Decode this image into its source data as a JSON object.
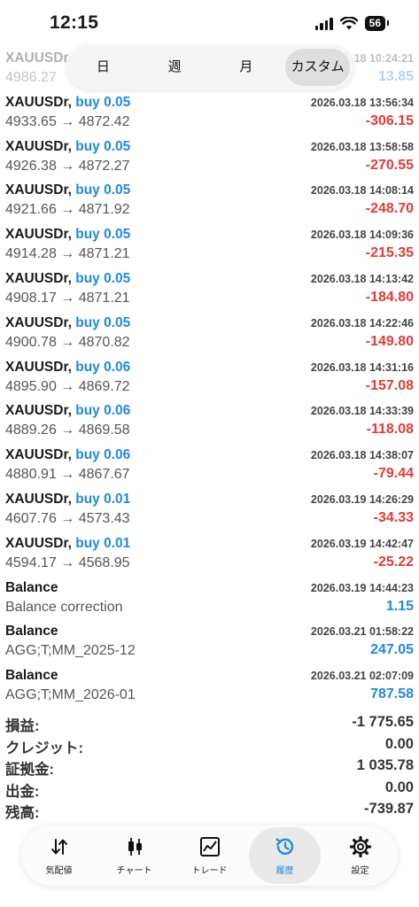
{
  "status_bar": {
    "time": "12:15",
    "battery": "56"
  },
  "partial_row": {
    "symbol": "XAUUSDr,",
    "datetime": "18 10:24:21",
    "prices": "4986.27",
    "profit": "13.85"
  },
  "period_tabs": [
    {
      "label": "日",
      "active": false
    },
    {
      "label": "週",
      "active": false
    },
    {
      "label": "月",
      "active": false
    },
    {
      "label": "カスタム",
      "active": true
    }
  ],
  "deals": [
    {
      "symbol": "XAUUSDr,",
      "direction": "buy 0.05",
      "datetime": "2026.03.18 13:56:34",
      "prices": "4933.65 → 4872.42",
      "profit": "-306.15",
      "sign": "neg"
    },
    {
      "symbol": "XAUUSDr,",
      "direction": "buy 0.05",
      "datetime": "2026.03.18 13:58:58",
      "prices": "4926.38 → 4872.27",
      "profit": "-270.55",
      "sign": "neg"
    },
    {
      "symbol": "XAUUSDr,",
      "direction": "buy 0.05",
      "datetime": "2026.03.18 14:08:14",
      "prices": "4921.66 → 4871.92",
      "profit": "-248.70",
      "sign": "neg"
    },
    {
      "symbol": "XAUUSDr,",
      "direction": "buy 0.05",
      "datetime": "2026.03.18 14:09:36",
      "prices": "4914.28 → 4871.21",
      "profit": "-215.35",
      "sign": "neg"
    },
    {
      "symbol": "XAUUSDr,",
      "direction": "buy 0.05",
      "datetime": "2026.03.18 14:13:42",
      "prices": "4908.17 → 4871.21",
      "profit": "-184.80",
      "sign": "neg"
    },
    {
      "symbol": "XAUUSDr,",
      "direction": "buy 0.05",
      "datetime": "2026.03.18 14:22:46",
      "prices": "4900.78 → 4870.82",
      "profit": "-149.80",
      "sign": "neg"
    },
    {
      "symbol": "XAUUSDr,",
      "direction": "buy 0.06",
      "datetime": "2026.03.18 14:31:16",
      "prices": "4895.90 → 4869.72",
      "profit": "-157.08",
      "sign": "neg"
    },
    {
      "symbol": "XAUUSDr,",
      "direction": "buy 0.06",
      "datetime": "2026.03.18 14:33:39",
      "prices": "4889.26 → 4869.58",
      "profit": "-118.08",
      "sign": "neg"
    },
    {
      "symbol": "XAUUSDr,",
      "direction": "buy 0.06",
      "datetime": "2026.03.18 14:38:07",
      "prices": "4880.91 → 4867.67",
      "profit": "-79.44",
      "sign": "neg"
    },
    {
      "symbol": "XAUUSDr,",
      "direction": "buy 0.01",
      "datetime": "2026.03.19 14:26:29",
      "prices": "4607.76 → 4573.43",
      "profit": "-34.33",
      "sign": "neg"
    },
    {
      "symbol": "XAUUSDr,",
      "direction": "buy 0.01",
      "datetime": "2026.03.19 14:42:47",
      "prices": "4594.17 → 4568.95",
      "profit": "-25.22",
      "sign": "neg"
    },
    {
      "symbol": "Balance",
      "direction": "",
      "datetime": "2026.03.19 14:44:23",
      "prices": "Balance correction",
      "profit": "1.15",
      "sign": "pos"
    },
    {
      "symbol": "Balance",
      "direction": "",
      "datetime": "2026.03.21 01:58:22",
      "prices": "AGG;T;MM_2025-12",
      "profit": "247.05",
      "sign": "pos"
    },
    {
      "symbol": "Balance",
      "direction": "",
      "datetime": "2026.03.21 02:07:09",
      "prices": "AGG;T;MM_2026-01",
      "profit": "787.58",
      "sign": "pos"
    }
  ],
  "summary": [
    {
      "label": "損益:",
      "value": "-1 775.65"
    },
    {
      "label": "クレジット:",
      "value": "0.00"
    },
    {
      "label": "証拠金:",
      "value": "1 035.78"
    },
    {
      "label": "出金:",
      "value": "0.00"
    },
    {
      "label": "残高:",
      "value": "-739.87"
    }
  ],
  "tab_bar": [
    {
      "label": "気配値",
      "icon": "quotes-arrows-icon",
      "active": false
    },
    {
      "label": "チャート",
      "icon": "candlestick-chart-icon",
      "active": false
    },
    {
      "label": "トレード",
      "icon": "trade-line-chart-icon",
      "active": false
    },
    {
      "label": "履歴",
      "icon": "history-clock-icon",
      "active": true
    },
    {
      "label": "設定",
      "icon": "gear-icon",
      "active": false
    }
  ],
  "colors": {
    "buy": "#1e88e5",
    "loss": "#e53935",
    "gain": "#1e88e5",
    "active_tab": "#1e88e5"
  }
}
